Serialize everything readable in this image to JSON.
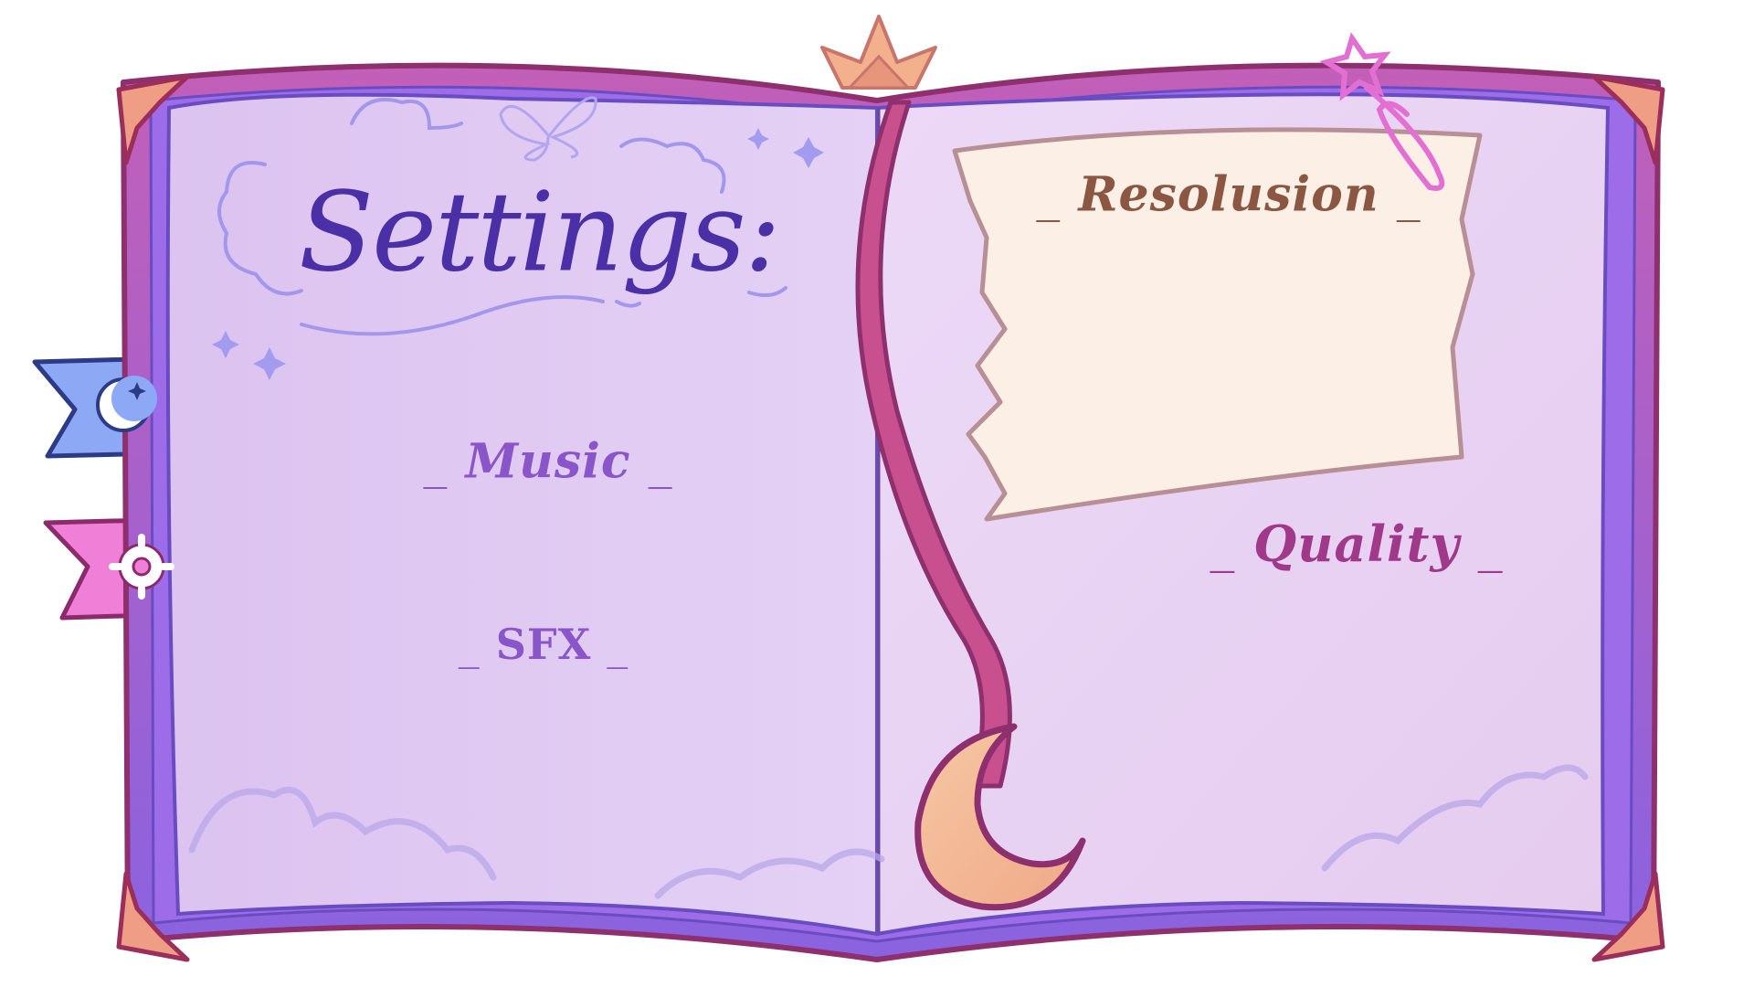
{
  "menu": {
    "title": "Settings:",
    "items": {
      "music": "Music",
      "sfx": "SFX",
      "resolution": "Resolusion",
      "quality": "Quality"
    },
    "dash": "_"
  },
  "tabs": [
    {
      "icon": "moon-star-icon",
      "glyph": "☾"
    },
    {
      "icon": "gear-icon",
      "glyph": "⚙"
    }
  ],
  "colors": {
    "cover_outer": "#a03a78",
    "cover_purple": "#9b5cd6",
    "page": "#e8d2f3",
    "page_shade": "#dcc2ee",
    "ribbon": "#c8508f",
    "moon_charm": "#f5bf9b",
    "paper_note": "#fbefe6",
    "tab_blue": "#8da8f5",
    "tab_pink": "#f07fd8",
    "title": "#4a2fa6",
    "music_label": "#8a55c8",
    "sfx_label": "#8a55c8",
    "resolution_label": "#8c5742",
    "quality_label": "#a1398b"
  }
}
